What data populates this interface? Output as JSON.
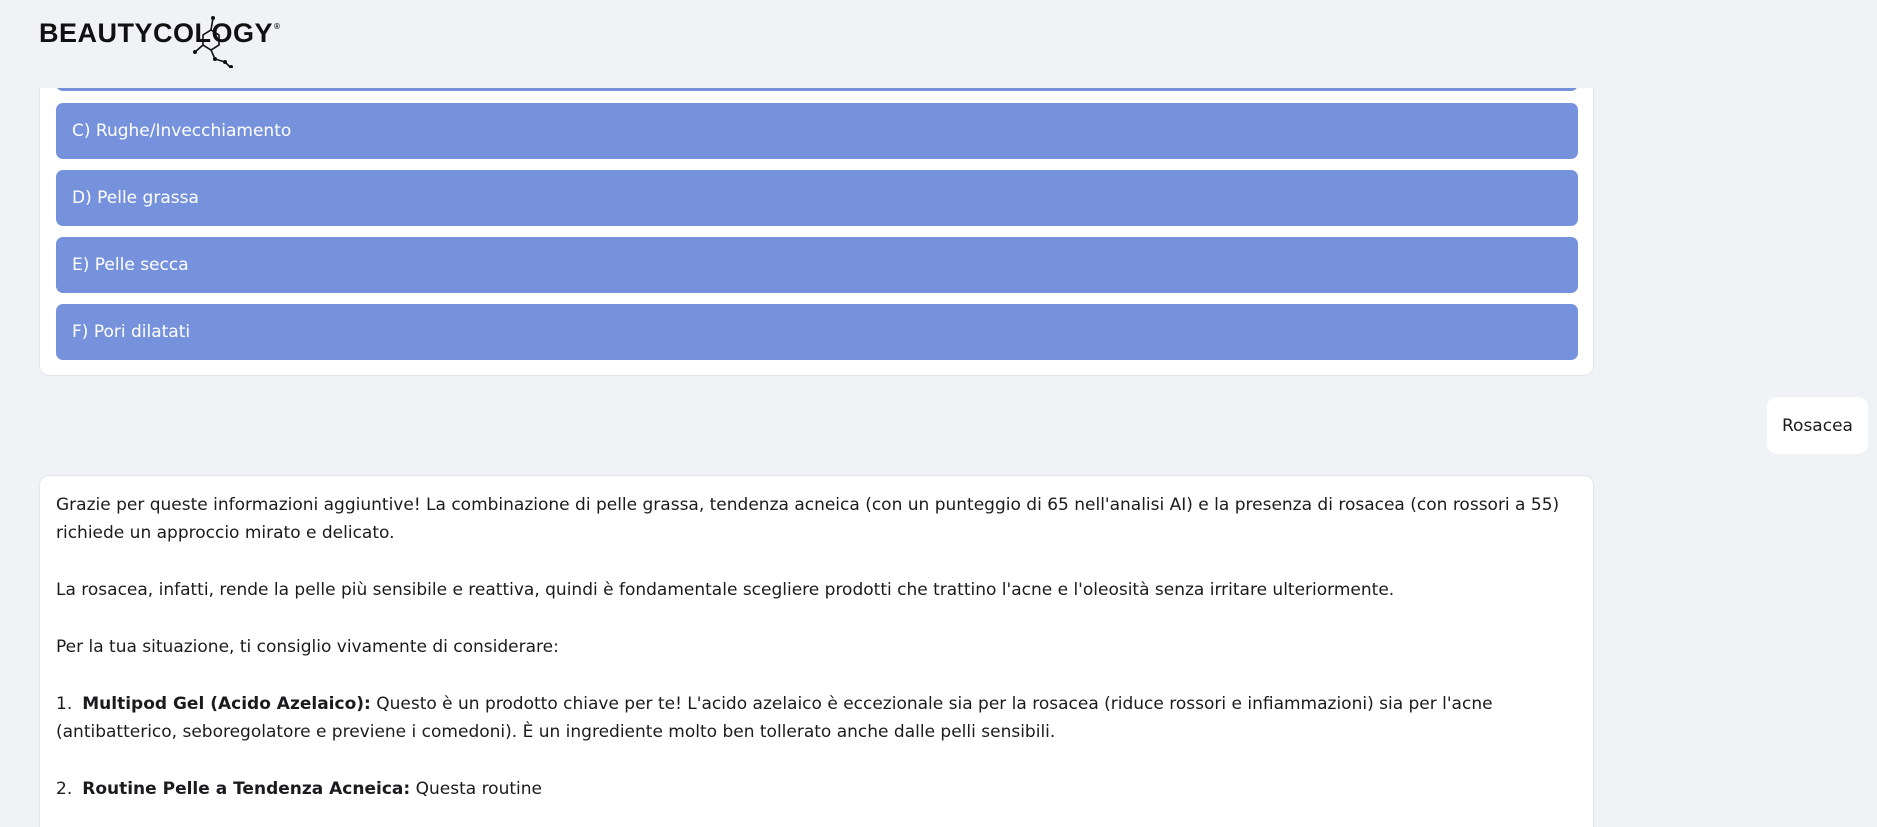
{
  "brand": {
    "logo_text": "BEAUTYCOLOGY",
    "logo_mark": "®"
  },
  "quiz": {
    "options": [
      {
        "label": "C) Rughe/Invecchiamento"
      },
      {
        "label": "D) Pelle grassa"
      },
      {
        "label": "E) Pelle secca"
      },
      {
        "label": "F) Pori dilatati"
      }
    ]
  },
  "user_message": {
    "text": "Rosacea"
  },
  "bot_message": {
    "paragraph_1": "Grazie per queste informazioni aggiuntive! La combinazione di pelle grassa, tendenza acneica (con un punteggio di 65 nell'analisi AI) e la presenza di rosacea (con rossori a 55) richiede un approccio mirato e delicato.",
    "paragraph_2": "La rosacea, infatti, rende la pelle più sensibile e reattiva, quindi è fondamentale scegliere prodotti che trattino l'acne e l'oleosità senza irritare ulteriormente.",
    "paragraph_3": "Per la tua situazione, ti consiglio vivamente di considerare:",
    "item_1": {
      "number": "1.",
      "title": "Multipod Gel (Acido Azelaico):",
      "text": " Questo è un prodotto chiave per te! L'acido azelaico è eccezionale sia per la rosacea (riduce rossori e infiammazioni) sia per l'acne (antibatterico, seboregolatore e previene i comedoni). È un ingrediente molto ben tollerato anche dalle pelli sensibili."
    },
    "item_2": {
      "number": "2.",
      "title": "Routine Pelle a Tendenza Acneica:",
      "text": " Questa routine"
    }
  },
  "colors": {
    "background": "#f1f2f6",
    "option_fill": "#7792dc",
    "card": "#ffffff"
  }
}
